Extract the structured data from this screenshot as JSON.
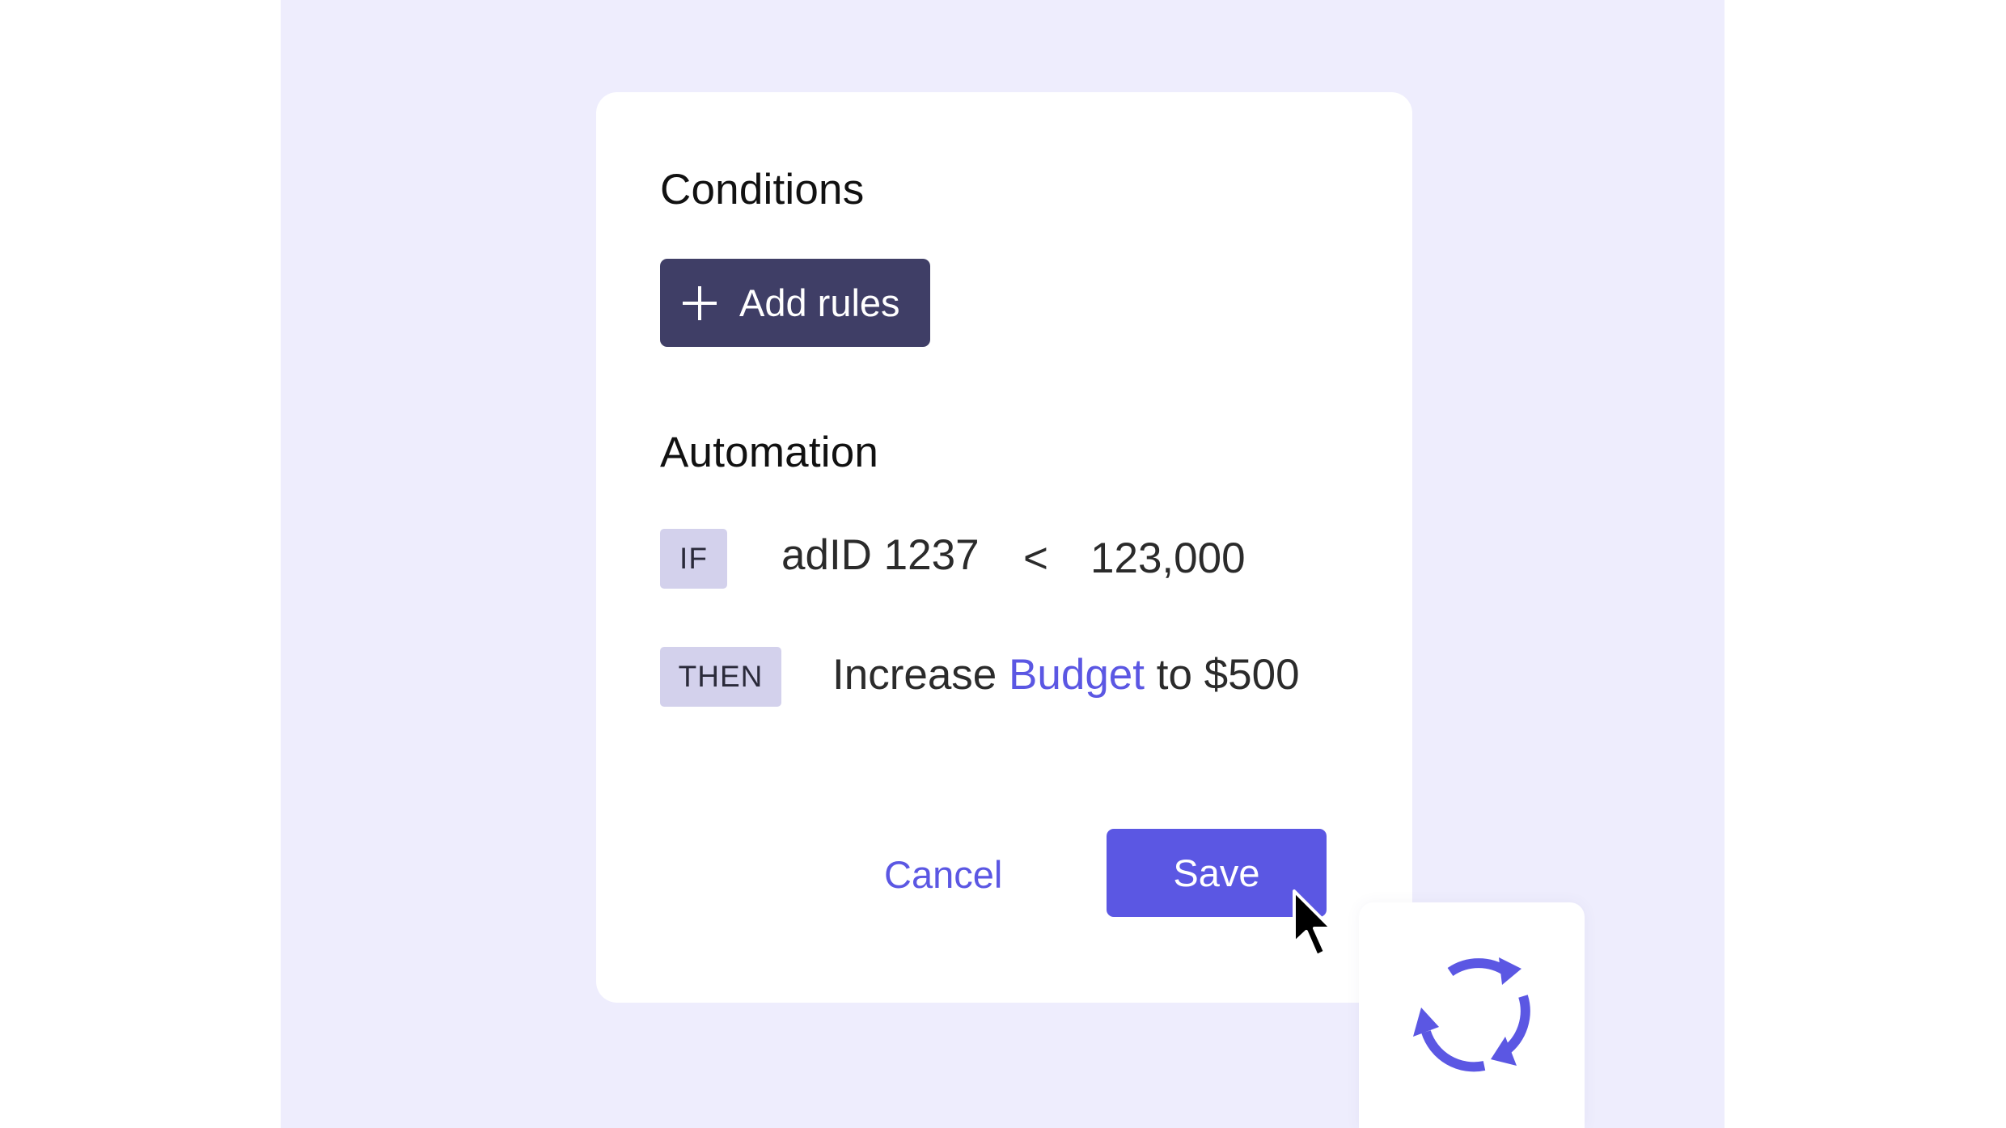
{
  "colors": {
    "background_panel": "#eeedfd",
    "primary": "#5b57e3",
    "dark_button": "#3f3e66",
    "tag_bg": "#d3d1ec"
  },
  "conditions": {
    "title": "Conditions",
    "add_button_label": "Add rules",
    "add_button_icon": "plus-icon"
  },
  "automation": {
    "title": "Automation",
    "if_tag": "IF",
    "condition": {
      "field": "adID 1237",
      "operator": "<",
      "value": "123,000"
    },
    "then_tag": "THEN",
    "action": {
      "prefix": "Increase",
      "link": "Budget",
      "suffix": "to $500"
    }
  },
  "footer": {
    "cancel_label": "Cancel",
    "save_label": "Save"
  },
  "icons": {
    "cursor": "mouse-pointer-icon",
    "sync": "sync-icon"
  }
}
